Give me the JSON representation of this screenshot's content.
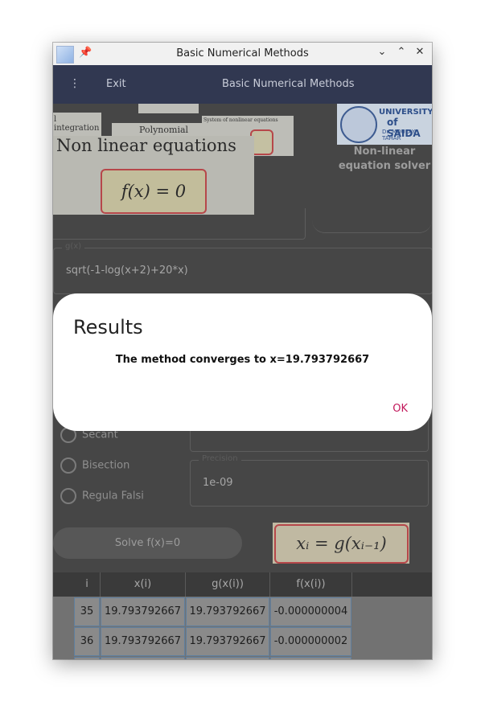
{
  "window": {
    "title": "Basic Numerical Methods",
    "controls": {
      "minimize": "⌄",
      "maximize": "⌃",
      "close": "✕"
    },
    "pin_icon": "pin-icon",
    "app_icon": "app-icon"
  },
  "appbar": {
    "menu_icon": "⋮",
    "exit_label": "Exit",
    "title": "Basic Numerical Methods"
  },
  "thumbnails": {
    "integration": "l integration",
    "polynomial": "Polynomial approximation",
    "systems": "System of nonlinear equations",
    "main_heading": "Non linear equations",
    "main_formula": "f(x) = 0"
  },
  "university": {
    "line1": "UNIVERSITY",
    "line2": "of SAIDA",
    "line3": "Dr. MOULAY TAHAR",
    "caption_line1": "Non-linear",
    "caption_line2": "equation solver"
  },
  "gx_field": {
    "label": "g(x)",
    "value": "sqrt(-1-log(x+2)+20*x)"
  },
  "methods": [
    {
      "label": "Secant"
    },
    {
      "label": "Bisection"
    },
    {
      "label": "Regula Falsi"
    }
  ],
  "precision_field": {
    "label": "Precision",
    "value": "1e-09"
  },
  "solve_button": "Solve f(x)=0",
  "iteration_formula": "xᵢ = g(xᵢ₋₁)",
  "table": {
    "headers": [
      "i",
      "x(i)",
      "g(x(i))",
      "f(x(i))"
    ],
    "rows": [
      [
        "35",
        "19.793792667",
        "19.793792667",
        "-0.000000004"
      ],
      [
        "36",
        "19.793792667",
        "19.793792667",
        "-0.000000002"
      ]
    ]
  },
  "dialog": {
    "title": "Results",
    "message": "The method converges to x=19.793792667",
    "ok_label": "OK",
    "accent": "#c2185b"
  },
  "colors": {
    "appbar": "#313851",
    "background": "#464646"
  }
}
